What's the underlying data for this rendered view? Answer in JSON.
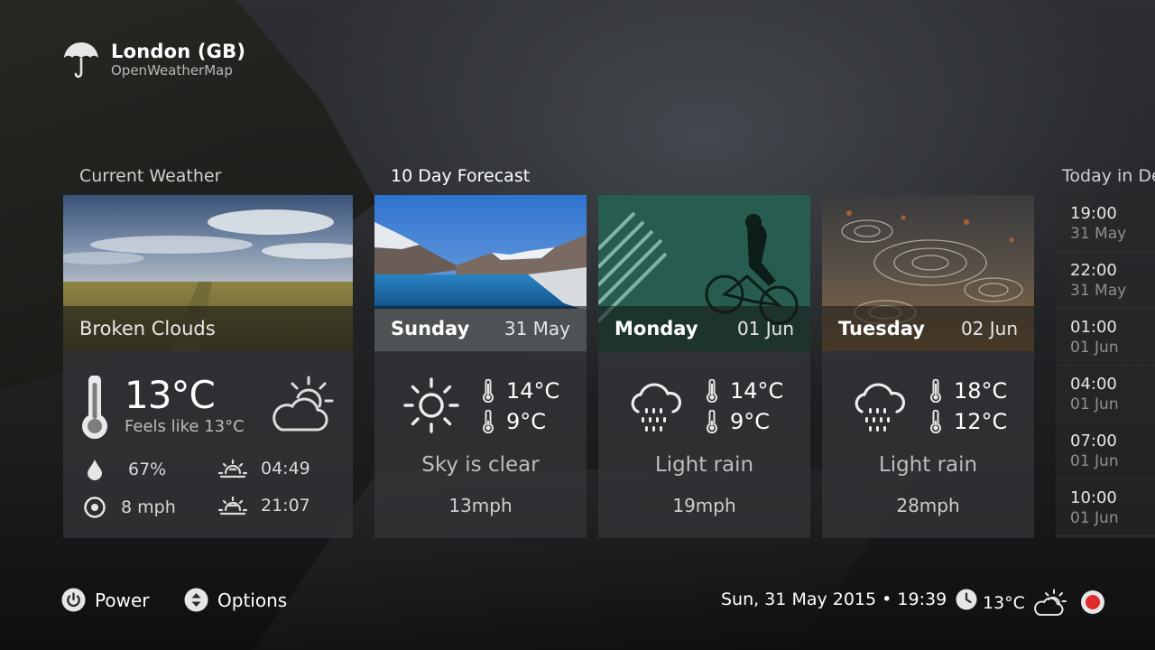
{
  "header": {
    "location": "London (GB)",
    "provider": "OpenWeatherMap"
  },
  "sections": {
    "current": "Current Weather",
    "forecast": "10 Day Forecast",
    "hourly": "Today in Detail"
  },
  "current": {
    "condition": "Broken Clouds",
    "temperature": "13°C",
    "feels_like": "Feels like 13°C",
    "humidity": "67%",
    "wind": "8 mph",
    "sunrise": "04:49",
    "sunset": "21:07",
    "icon": "cloud-sun-icon"
  },
  "forecast": [
    {
      "day": "Sunday",
      "date": "31 May",
      "high": "14°C",
      "low": "9°C",
      "desc": "Sky is clear",
      "wind": "13mph",
      "icon": "sun-icon"
    },
    {
      "day": "Monday",
      "date": "01 Jun",
      "high": "14°C",
      "low": "9°C",
      "desc": "Light rain",
      "wind": "19mph",
      "icon": "rain-cloud-icon"
    },
    {
      "day": "Tuesday",
      "date": "02 Jun",
      "high": "18°C",
      "low": "12°C",
      "desc": "Light rain",
      "wind": "28mph",
      "icon": "rain-cloud-icon"
    }
  ],
  "hourly": [
    {
      "time": "19:00",
      "date": "31 May"
    },
    {
      "time": "22:00",
      "date": "31 May"
    },
    {
      "time": "01:00",
      "date": "01 Jun"
    },
    {
      "time": "04:00",
      "date": "01 Jun"
    },
    {
      "time": "07:00",
      "date": "01 Jun"
    },
    {
      "time": "10:00",
      "date": "01 Jun"
    }
  ],
  "footer": {
    "power": "Power",
    "options": "Options",
    "datetime": "Sun, 31 May 2015 • 19:39",
    "temperature": "13°C"
  },
  "colors": {
    "record": "#e02a2a",
    "card_bg": "#343538"
  }
}
